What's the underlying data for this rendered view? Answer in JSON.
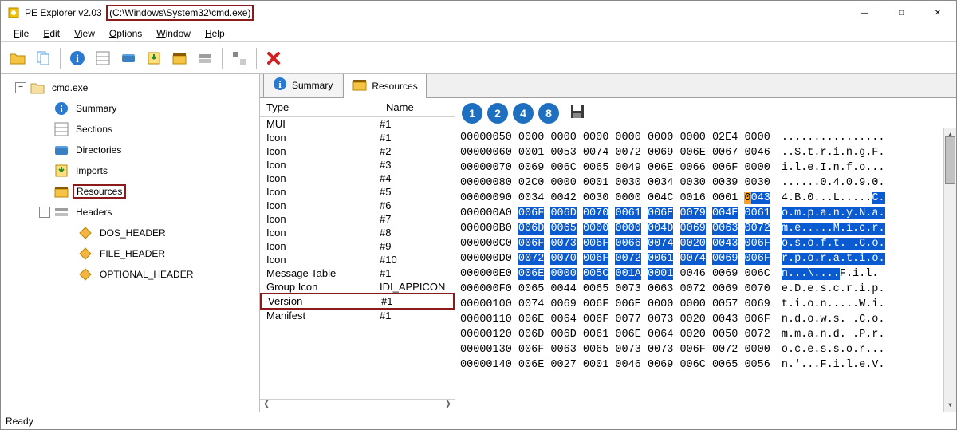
{
  "title_prefix": "PE Explorer v2.03",
  "title_path": "(C:\\Windows\\System32\\cmd.exe)",
  "menus": [
    "File",
    "Edit",
    "View",
    "Options",
    "Window",
    "Help"
  ],
  "toolbar": [
    {
      "name": "open-file-icon"
    },
    {
      "name": "copy-icon"
    },
    {
      "sep": true
    },
    {
      "name": "info-icon"
    },
    {
      "name": "sections-icon"
    },
    {
      "name": "directories-icon"
    },
    {
      "name": "imports-icon"
    },
    {
      "name": "resources-icon"
    },
    {
      "name": "headers-icon"
    },
    {
      "sep": true
    },
    {
      "name": "toggle-icon"
    },
    {
      "sep": true
    },
    {
      "name": "delete-icon"
    }
  ],
  "tree": {
    "root": "cmd.exe",
    "children": [
      {
        "icon": "info",
        "label": "Summary"
      },
      {
        "icon": "sections",
        "label": "Sections"
      },
      {
        "icon": "dirs",
        "label": "Directories"
      },
      {
        "icon": "imports",
        "label": "Imports"
      },
      {
        "icon": "resources",
        "label": "Resources",
        "highlight": true
      },
      {
        "icon": "headers",
        "label": "Headers",
        "expand": true,
        "children": [
          {
            "icon": "hdr",
            "label": "DOS_HEADER"
          },
          {
            "icon": "hdr",
            "label": "FILE_HEADER"
          },
          {
            "icon": "hdr",
            "label": "OPTIONAL_HEADER"
          }
        ]
      }
    ]
  },
  "tabs": [
    {
      "icon": "info",
      "label": "Summary",
      "active": false
    },
    {
      "icon": "resources",
      "label": "Resources",
      "active": true
    }
  ],
  "res_list": {
    "headers": [
      "Type",
      "Name"
    ],
    "rows": [
      {
        "type": "MUI",
        "name": "#1"
      },
      {
        "type": "Icon",
        "name": "#1"
      },
      {
        "type": "Icon",
        "name": "#2"
      },
      {
        "type": "Icon",
        "name": "#3"
      },
      {
        "type": "Icon",
        "name": "#4"
      },
      {
        "type": "Icon",
        "name": "#5"
      },
      {
        "type": "Icon",
        "name": "#6"
      },
      {
        "type": "Icon",
        "name": "#7"
      },
      {
        "type": "Icon",
        "name": "#8"
      },
      {
        "type": "Icon",
        "name": "#9"
      },
      {
        "type": "Icon",
        "name": "#10"
      },
      {
        "type": "Message Table",
        "name": "#1"
      },
      {
        "type": "Group Icon",
        "name": "IDI_APPICON"
      },
      {
        "type": "Version",
        "name": "#1",
        "highlight": true
      },
      {
        "type": "Manifest",
        "name": "#1"
      }
    ]
  },
  "hex_toolbar": {
    "circles": [
      "1",
      "2",
      "4",
      "8"
    ],
    "save_icon": "save-icon"
  },
  "hex_lines": [
    {
      "addr": "00000050",
      "bytes": [
        " 0000",
        " 0000",
        " 0000",
        " 0000",
        " 0000",
        " 0000",
        " 02E4",
        " 0000"
      ],
      "hl": [],
      "ascii": "................"
    },
    {
      "addr": "00000060",
      "bytes": [
        " 0001",
        " 0053",
        " 0074",
        " 0072",
        " 0069",
        " 006E",
        " 0067",
        " 0046"
      ],
      "hl": [],
      "ascii": "..S.t.r.i.n.g.F."
    },
    {
      "addr": "00000070",
      "bytes": [
        " 0069",
        " 006C",
        " 0065",
        " 0049",
        " 006E",
        " 0066",
        " 006F",
        " 0000"
      ],
      "hl": [],
      "ascii": "i.l.e.I.n.f.o..."
    },
    {
      "addr": "00000080",
      "bytes": [
        " 02C0",
        " 0000",
        " 0001",
        " 0030",
        " 0034",
        " 0030",
        " 0039",
        " 0030"
      ],
      "hl": [],
      "ascii": "......0.4.0.9.0."
    },
    {
      "addr": "00000090",
      "bytes": [
        " 0034",
        " 0042",
        " 0030",
        " 0000",
        " 004C",
        " 0016",
        " 0001",
        " 0043"
      ],
      "hl": [
        7
      ],
      "hlo": 7,
      "ascii": "4.B.0...L.....",
      "ascii_hl": "C.",
      "ascii_hl_start": 14
    },
    {
      "addr": "000000A0",
      "bytes": [
        " 006F",
        " 006D",
        " 0070",
        " 0061",
        " 006E",
        " 0079",
        " 004E",
        " 0061"
      ],
      "hl": [
        0,
        1,
        2,
        3,
        4,
        5,
        6,
        7
      ],
      "ascii_hl": "o.m.p.a.n.y.N.a.",
      "ascii_hl_start": 0
    },
    {
      "addr": "000000B0",
      "bytes": [
        " 006D",
        " 0065",
        " 0000",
        " 0000",
        " 004D",
        " 0069",
        " 0063",
        " 0072"
      ],
      "hl": [
        0,
        1,
        2,
        3,
        4,
        5,
        6,
        7
      ],
      "ascii_hl": "m.e.....M.i.c.r.",
      "ascii_hl_start": 0
    },
    {
      "addr": "000000C0",
      "bytes": [
        " 006F",
        " 0073",
        " 006F",
        " 0066",
        " 0074",
        " 0020",
        " 0043",
        " 006F"
      ],
      "hl": [
        0,
        1,
        2,
        3,
        4,
        5,
        6,
        7
      ],
      "ascii_hl": "o.s.o.f.t. .C.o.",
      "ascii_hl_start": 0
    },
    {
      "addr": "000000D0",
      "bytes": [
        " 0072",
        " 0070",
        " 006F",
        " 0072",
        " 0061",
        " 0074",
        " 0069",
        " 006F"
      ],
      "hl": [
        0,
        1,
        2,
        3,
        4,
        5,
        6,
        7
      ],
      "ascii_hl": "r.p.o.r.a.t.i.o.",
      "ascii_hl_start": 0
    },
    {
      "addr": "000000E0",
      "bytes": [
        " 006E",
        " 0000",
        " 005C",
        " 001A",
        " 0001",
        " 0046",
        " 0069",
        " 006C"
      ],
      "hl": [
        0,
        1,
        2,
        3,
        4
      ],
      "ascii_hl": "n...\\....",
      "ascii_hl_start": 0,
      "ascii_tail": "F.i.l."
    },
    {
      "addr": "000000F0",
      "bytes": [
        " 0065",
        " 0044",
        " 0065",
        " 0073",
        " 0063",
        " 0072",
        " 0069",
        " 0070"
      ],
      "hl": [],
      "ascii": "e.D.e.s.c.r.i.p."
    },
    {
      "addr": "00000100",
      "bytes": [
        " 0074",
        " 0069",
        " 006F",
        " 006E",
        " 0000",
        " 0000",
        " 0057",
        " 0069"
      ],
      "hl": [],
      "ascii": "t.i.o.n.....W.i."
    },
    {
      "addr": "00000110",
      "bytes": [
        " 006E",
        " 0064",
        " 006F",
        " 0077",
        " 0073",
        " 0020",
        " 0043",
        " 006F"
      ],
      "hl": [],
      "ascii": "n.d.o.w.s. .C.o."
    },
    {
      "addr": "00000120",
      "bytes": [
        " 006D",
        " 006D",
        " 0061",
        " 006E",
        " 0064",
        " 0020",
        " 0050",
        " 0072"
      ],
      "hl": [],
      "ascii": "m.m.a.n.d. .P.r."
    },
    {
      "addr": "00000130",
      "bytes": [
        " 006F",
        " 0063",
        " 0065",
        " 0073",
        " 0073",
        " 006F",
        " 0072",
        " 0000"
      ],
      "hl": [],
      "ascii": "o.c.e.s.s.o.r..."
    },
    {
      "addr": "00000140",
      "bytes": [
        " 006E",
        " 0027",
        " 0001",
        " 0046",
        " 0069",
        " 006C",
        " 0065",
        " 0056"
      ],
      "hl": [],
      "ascii": "n.'...F.i.l.e.V."
    }
  ],
  "status": "Ready"
}
